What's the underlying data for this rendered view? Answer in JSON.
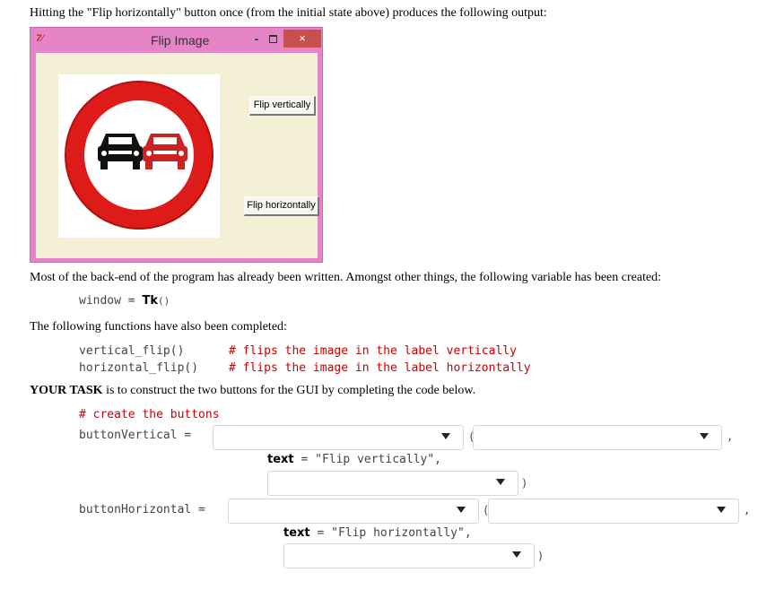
{
  "intro": "Hitting the \"Flip horizontally\" button once (from the initial state above) produces the following output:",
  "window": {
    "logo_text": "7⁄",
    "title": "Flip Image",
    "minimize_symbol": "-",
    "close_symbol": "×",
    "btn_vertical": "Flip vertically",
    "btn_horizontal": "Flip horizontally",
    "colors": {
      "frame": "#e684c8",
      "client": "#f4f0d6",
      "close": "#c7504f",
      "sign_red": "#dd1c1a",
      "car_left": "#111111",
      "car_right": "#cc2222"
    }
  },
  "para_backend": "Most of the back-end of the program has already been written.  Amongst other things, the following variable has been created:",
  "code_window_var": "window",
  "code_window_eq": " = ",
  "code_window_tk": "Tk",
  "code_window_paren": "()",
  "para_functions": "The following functions have also been completed:",
  "functions": [
    {
      "call": "vertical_flip()",
      "comment": "# flips the image in the label vertically"
    },
    {
      "call": "horizontal_flip()",
      "comment": "# flips the image in the label horizontally"
    }
  ],
  "task_bold": "YOUR TASK",
  "task_rest": " is to construct the two buttons for the GUI by completing the code below.",
  "code_comment": "# create the buttons",
  "vertical": {
    "var": "buttonVertical",
    "eq": " = ",
    "open_paren": "(",
    "comma": ",",
    "text_kw": "text",
    "text_rest": " = \"Flip vertically\",",
    "close_paren": ")"
  },
  "horizontal": {
    "var": "buttonHorizontal",
    "eq": " = ",
    "open_paren": "(",
    "comma": ",",
    "text_kw": "text",
    "text_rest": " = \"Flip horizontally\",",
    "close_paren": ")"
  }
}
